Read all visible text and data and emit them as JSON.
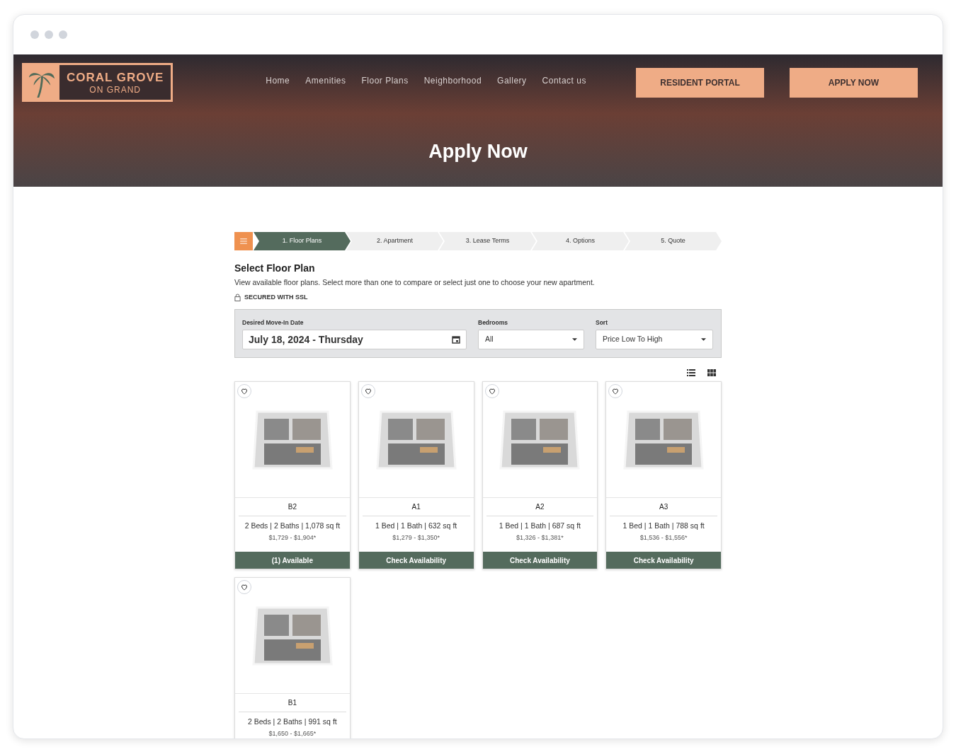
{
  "brand": {
    "name": "CORAL GROVE",
    "tagline": "ON GRAND"
  },
  "nav": [
    "Home",
    "Amenities",
    "Floor Plans",
    "Neighborhood",
    "Gallery",
    "Contact us"
  ],
  "header_buttons": [
    "RESIDENT PORTAL",
    "APPLY NOW"
  ],
  "hero_title": "Apply Now",
  "steps": [
    {
      "label": "1. Floor Plans",
      "selected": true
    },
    {
      "label": "2. Apartment",
      "selected": false
    },
    {
      "label": "3. Lease Terms",
      "selected": false
    },
    {
      "label": "4. Options",
      "selected": false
    },
    {
      "label": "5. Quote",
      "selected": false
    }
  ],
  "section": {
    "title": "Select Floor Plan",
    "description": "View available floor plans. Select more than one to compare or select just one to choose your new apartment.",
    "secure_note": "SECURED WITH SSL"
  },
  "filters": {
    "move_in": {
      "label": "Desired Move-In Date",
      "value": "July 18, 2024 - Thursday"
    },
    "bedrooms": {
      "label": "Bedrooms",
      "value": "All"
    },
    "sort": {
      "label": "Sort",
      "value": "Price Low To High"
    }
  },
  "floor_plans": [
    {
      "name": "B2",
      "details": "2 Beds | 2 Baths | 1,078 sq ft",
      "price": "$1,729 - $1,904*",
      "button": "(1) Available"
    },
    {
      "name": "A1",
      "details": "1 Bed | 1 Bath | 632 sq ft",
      "price": "$1,279 - $1,350*",
      "button": "Check Availability"
    },
    {
      "name": "A2",
      "details": "1 Bed | 1 Bath | 687 sq ft",
      "price": "$1,326 - $1,381*",
      "button": "Check Availability"
    },
    {
      "name": "A3",
      "details": "1 Bed | 1 Bath | 788 sq ft",
      "price": "$1,536 - $1,556*",
      "button": "Check Availability"
    },
    {
      "name": "B1",
      "details": "2 Beds | 2 Baths | 991 sq ft",
      "price": "$1,650 - $1,665*"
    }
  ]
}
